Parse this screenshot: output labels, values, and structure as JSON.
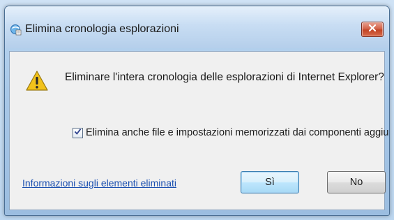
{
  "dialog": {
    "title": "Elimina cronologia esplorazioni",
    "message": "Eliminare l'intera cronologia delle esplorazioni di Internet Explorer?",
    "checkbox": {
      "label": "Elimina anche file e impostazioni memorizzati dai componenti aggiuntivi.",
      "checked": true
    },
    "link": "Informazioni sugli elementi eliminati",
    "buttons": {
      "yes": "Sì",
      "no": "No"
    },
    "icons": {
      "title": "internet-explorer-icon",
      "warning": "warning-icon",
      "close": "close-icon",
      "check": "checkmark-icon"
    },
    "colors": {
      "close_button": "#c24526",
      "link": "#1a4fb0",
      "warning": "#f2c21b"
    }
  }
}
